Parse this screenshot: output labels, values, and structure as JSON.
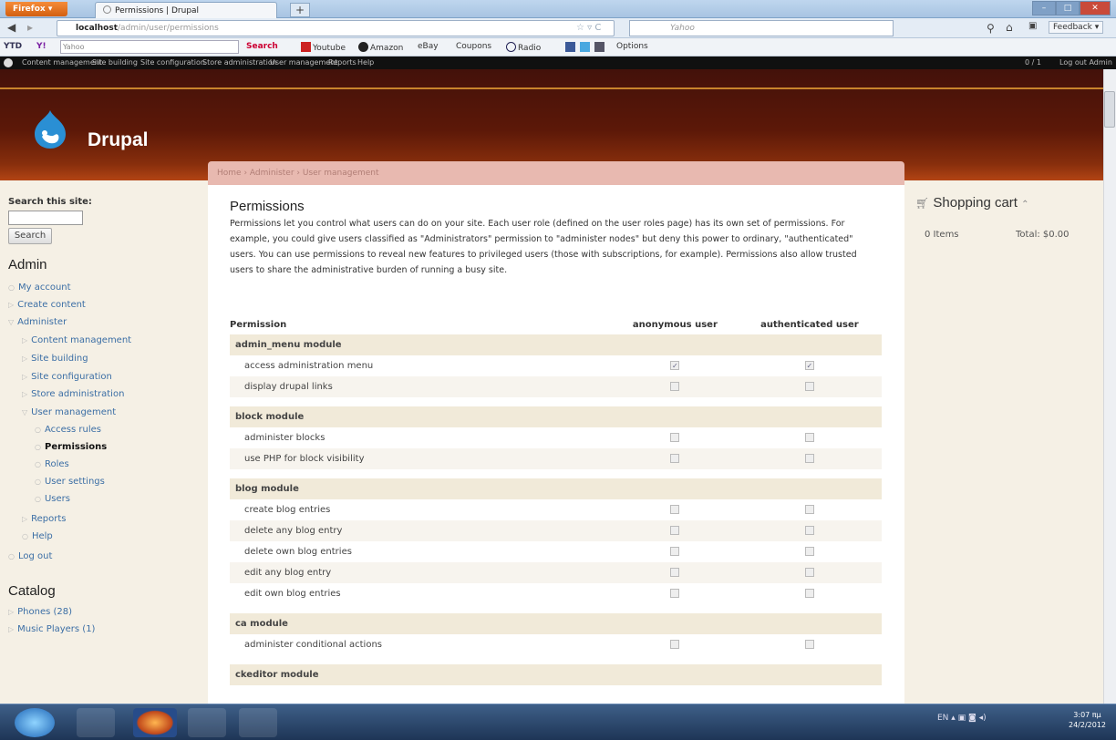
{
  "browser": {
    "menu_button": "Firefox",
    "tab_title": "Permissions | Drupal",
    "url_host": "localhost",
    "url_path": "/admin/user/permissions",
    "search_engine": "Yahoo",
    "feedback": "Feedback"
  },
  "ytd_toolbar": {
    "logo": "YTD",
    "search_placeholder": "Yahoo",
    "search_label": "Search",
    "links": [
      "Youtube",
      "Amazon",
      "eBay",
      "Coupons",
      "Radio",
      "Options"
    ]
  },
  "admin_menu": {
    "items": [
      "Content management",
      "Site building",
      "Site configuration",
      "Store administration",
      "User management",
      "Reports",
      "Help"
    ],
    "user_count": "0 / 1",
    "logout": "Log out Admin"
  },
  "site": {
    "name": "Drupal",
    "breadcrumb": "Home › Administer › User management"
  },
  "sidebar": {
    "search_label": "Search this site:",
    "search_button": "Search",
    "admin_title": "Admin",
    "nav": [
      {
        "label": "My account",
        "marker": "○"
      },
      {
        "label": "Create content",
        "marker": "▷"
      },
      {
        "label": "Administer",
        "marker": "▽"
      },
      {
        "label": "Content management",
        "marker": "▷"
      },
      {
        "label": "Site building",
        "marker": "▷"
      },
      {
        "label": "Site configuration",
        "marker": "▷"
      },
      {
        "label": "Store administration",
        "marker": "▷"
      },
      {
        "label": "User management",
        "marker": "▽"
      },
      {
        "label": "Access rules",
        "marker": "○"
      },
      {
        "label": "Permissions",
        "marker": "○"
      },
      {
        "label": "Roles",
        "marker": "○"
      },
      {
        "label": "User settings",
        "marker": "○"
      },
      {
        "label": "Users",
        "marker": "○"
      },
      {
        "label": "Reports",
        "marker": "▷"
      },
      {
        "label": "Help",
        "marker": "○"
      },
      {
        "label": "Log out",
        "marker": "○"
      }
    ],
    "catalog_title": "Catalog",
    "catalog": [
      {
        "label": "Phones (28)",
        "marker": "▷"
      },
      {
        "label": "Music Players (1)",
        "marker": "▷"
      }
    ]
  },
  "main": {
    "title": "Permissions",
    "intro": "Permissions let you control what users can do on your site. Each user role (defined on the user roles page) has its own set of permissions. For example, you could give users classified as \"Administrators\" permission to \"administer nodes\" but deny this power to ordinary, \"authenticated\" users. You can use permissions to reveal new features to privileged users (those with subscriptions, for example). Permissions also allow trusted users to share the administrative burden of running a busy site.",
    "columns": [
      "Permission",
      "anonymous user",
      "authenticated user"
    ],
    "modules": [
      {
        "name": "admin_menu module",
        "perms": [
          {
            "name": "access administration menu",
            "anon": true,
            "auth": true
          },
          {
            "name": "display drupal links",
            "anon": false,
            "auth": false
          }
        ]
      },
      {
        "name": "block module",
        "perms": [
          {
            "name": "administer blocks",
            "anon": false,
            "auth": false
          },
          {
            "name": "use PHP for block visibility",
            "anon": false,
            "auth": false
          }
        ]
      },
      {
        "name": "blog module",
        "perms": [
          {
            "name": "create blog entries",
            "anon": false,
            "auth": false
          },
          {
            "name": "delete any blog entry",
            "anon": false,
            "auth": false
          },
          {
            "name": "delete own blog entries",
            "anon": false,
            "auth": false
          },
          {
            "name": "edit any blog entry",
            "anon": false,
            "auth": false
          },
          {
            "name": "edit own blog entries",
            "anon": false,
            "auth": false
          }
        ]
      },
      {
        "name": "ca module",
        "perms": [
          {
            "name": "administer conditional actions",
            "anon": false,
            "auth": false
          }
        ]
      },
      {
        "name": "ckeditor module",
        "perms": []
      }
    ]
  },
  "cart": {
    "title": "Shopping cart",
    "items": "0 Items",
    "total": "Total: $0.00"
  },
  "taskbar": {
    "lang": "EN",
    "time": "3:07 πμ",
    "date": "24/2/2012"
  },
  "colors": {
    "header_dark": "#43110a",
    "header_light": "#b24414",
    "sidebar_bg": "#f5f0e5",
    "link": "#3b6ea5",
    "module_row": "#f1ead9"
  }
}
